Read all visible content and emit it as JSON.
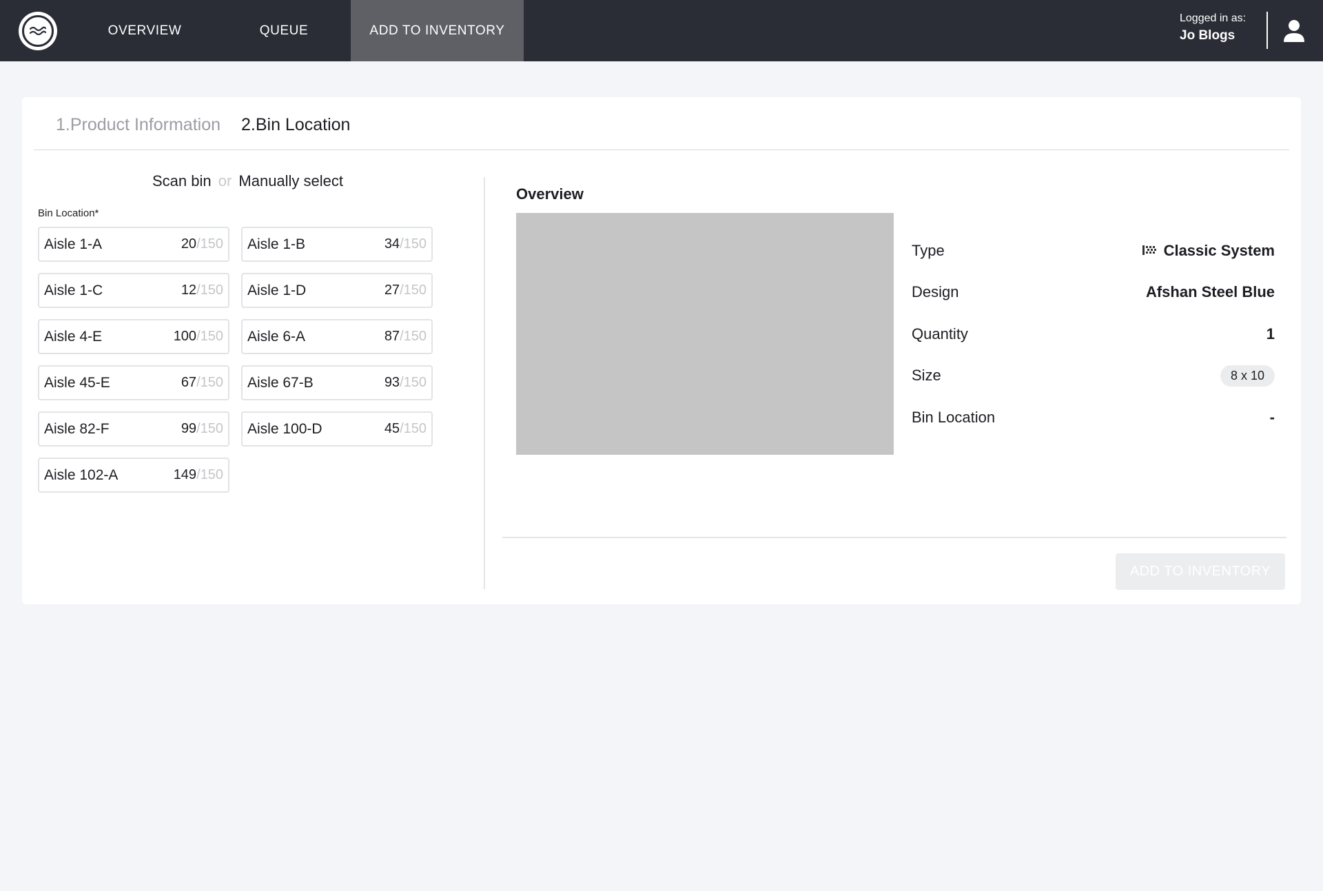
{
  "nav": {
    "tabs": [
      {
        "label": "OVERVIEW"
      },
      {
        "label": "QUEUE"
      },
      {
        "label": "ADD TO INVENTORY",
        "active": true
      }
    ]
  },
  "user": {
    "logged_in_label": "Logged in as:",
    "name": "Jo Blogs"
  },
  "steps": [
    {
      "label": "1.Product Information"
    },
    {
      "label": "2.Bin Location"
    }
  ],
  "bin_select": {
    "scan_label": "Scan bin",
    "or_label": "or",
    "manual_label": "Manually select",
    "field_label": "Bin Location*",
    "bins": [
      {
        "name": "Aisle 1-A",
        "count": "20",
        "capacity": "/150"
      },
      {
        "name": "Aisle 1-B",
        "count": "34",
        "capacity": "/150"
      },
      {
        "name": "Aisle 1-C",
        "count": "12",
        "capacity": "/150"
      },
      {
        "name": "Aisle 1-D",
        "count": "27",
        "capacity": "/150"
      },
      {
        "name": "Aisle 4-E",
        "count": "100",
        "capacity": "/150"
      },
      {
        "name": "Aisle 6-A",
        "count": "87",
        "capacity": "/150"
      },
      {
        "name": "Aisle 45-E",
        "count": "67",
        "capacity": "/150"
      },
      {
        "name": "Aisle 67-B",
        "count": "93",
        "capacity": "/150"
      },
      {
        "name": "Aisle 82-F",
        "count": "99",
        "capacity": "/150"
      },
      {
        "name": "Aisle 100-D",
        "count": "45",
        "capacity": "/150"
      },
      {
        "name": "Aisle 102-A",
        "count": "149",
        "capacity": "/150"
      }
    ]
  },
  "overview": {
    "title": "Overview",
    "details": {
      "type": {
        "label": "Type",
        "value": "Classic System",
        "icon": "pattern-icon"
      },
      "design": {
        "label": "Design",
        "value": "Afshan Steel Blue"
      },
      "quantity": {
        "label": "Quantity",
        "value": "1"
      },
      "size": {
        "label": "Size",
        "value": "8 x 10"
      },
      "bin_location": {
        "label": "Bin Location",
        "value": "-"
      }
    },
    "submit_label": "ADD TO INVENTORY"
  }
}
